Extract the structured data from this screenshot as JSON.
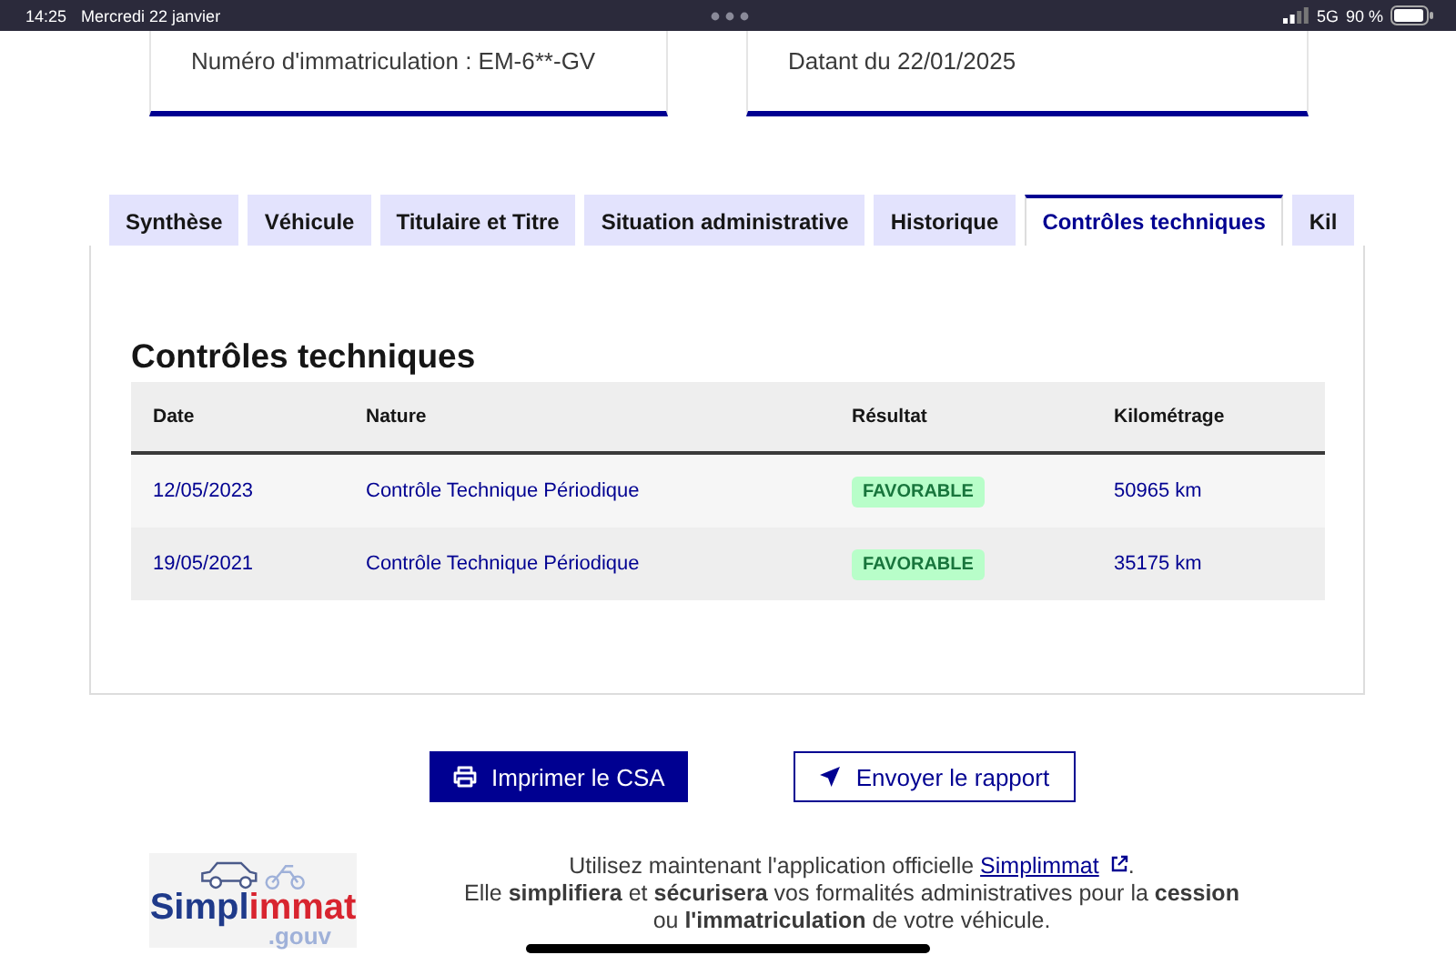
{
  "status_bar": {
    "time": "14:25",
    "date": "Mercredi 22 janvier",
    "network": "5G",
    "battery": "90 %"
  },
  "info_cards": [
    {
      "text": "Numéro d'immatriculation : EM-6**-GV"
    },
    {
      "text": "Datant du 22/01/2025"
    }
  ],
  "tabs": [
    {
      "label": "Synthèse",
      "selected": false
    },
    {
      "label": "Véhicule",
      "selected": false
    },
    {
      "label": "Titulaire et Titre",
      "selected": false
    },
    {
      "label": "Situation administrative",
      "selected": false
    },
    {
      "label": "Historique",
      "selected": false
    },
    {
      "label": "Contrôles techniques",
      "selected": true
    },
    {
      "label": "Kil",
      "selected": false
    }
  ],
  "section_title": "Contrôles techniques",
  "table": {
    "columns": [
      "Date",
      "Nature",
      "Résultat",
      "Kilométrage"
    ],
    "rows": [
      {
        "date": "12/05/2023",
        "nature": "Contrôle Technique Périodique",
        "result": "FAVORABLE",
        "mileage": "50965 km"
      },
      {
        "date": "19/05/2021",
        "nature": "Contrôle Technique Périodique",
        "result": "FAVORABLE",
        "mileage": "35175 km"
      }
    ]
  },
  "buttons": [
    {
      "kind": "primary",
      "label": "Imprimer le CSA"
    },
    {
      "kind": "secondary",
      "label": "Envoyer le rapport"
    }
  ],
  "logo": {
    "name_start": "Simpl",
    "name_end": "immat",
    "suffix": ".gouv"
  },
  "promo": {
    "before": "Utilisez maintenant l'application officielle ",
    "link": "Simplimmat",
    "after": ".",
    "second": "Elle **simplifiera** et **sécurisera** vos formalités administratives pour la **cession** ou **l'immatriculation** de votre véhicule."
  }
}
